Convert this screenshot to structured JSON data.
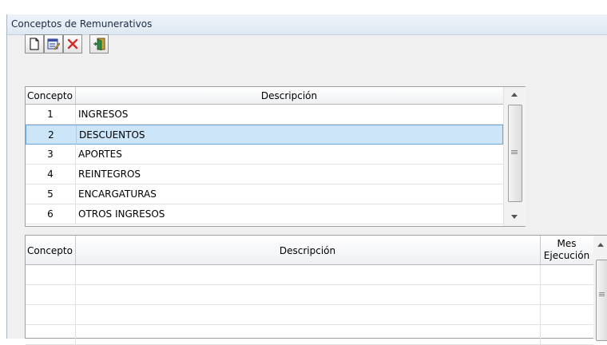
{
  "window": {
    "title": "Conceptos de Remunerativos"
  },
  "toolbar": {
    "buttons": [
      {
        "icon": "new-document-icon"
      },
      {
        "icon": "edit-icon"
      },
      {
        "icon": "delete-icon"
      },
      {
        "icon": "exit-door-icon"
      }
    ]
  },
  "grid_conceptos": {
    "headers": [
      "Concepto",
      "Descripción"
    ],
    "rows": [
      {
        "id": "1",
        "desc": "INGRESOS"
      },
      {
        "id": "2",
        "desc": "DESCUENTOS"
      },
      {
        "id": "3",
        "desc": "APORTES"
      },
      {
        "id": "4",
        "desc": "REINTEGROS"
      },
      {
        "id": "5",
        "desc": "ENCARGATURAS"
      },
      {
        "id": "6",
        "desc": "OTROS INGRESOS"
      }
    ],
    "selected_row": "2"
  },
  "grid_detalle": {
    "headers": [
      "Concepto",
      "Descripción",
      "Mes",
      "Ejecución"
    ],
    "rows": []
  },
  "colors": {
    "selection": "#cde5f9",
    "selection_border": "#6ea3d6",
    "delete_red": "#d42a2a"
  }
}
